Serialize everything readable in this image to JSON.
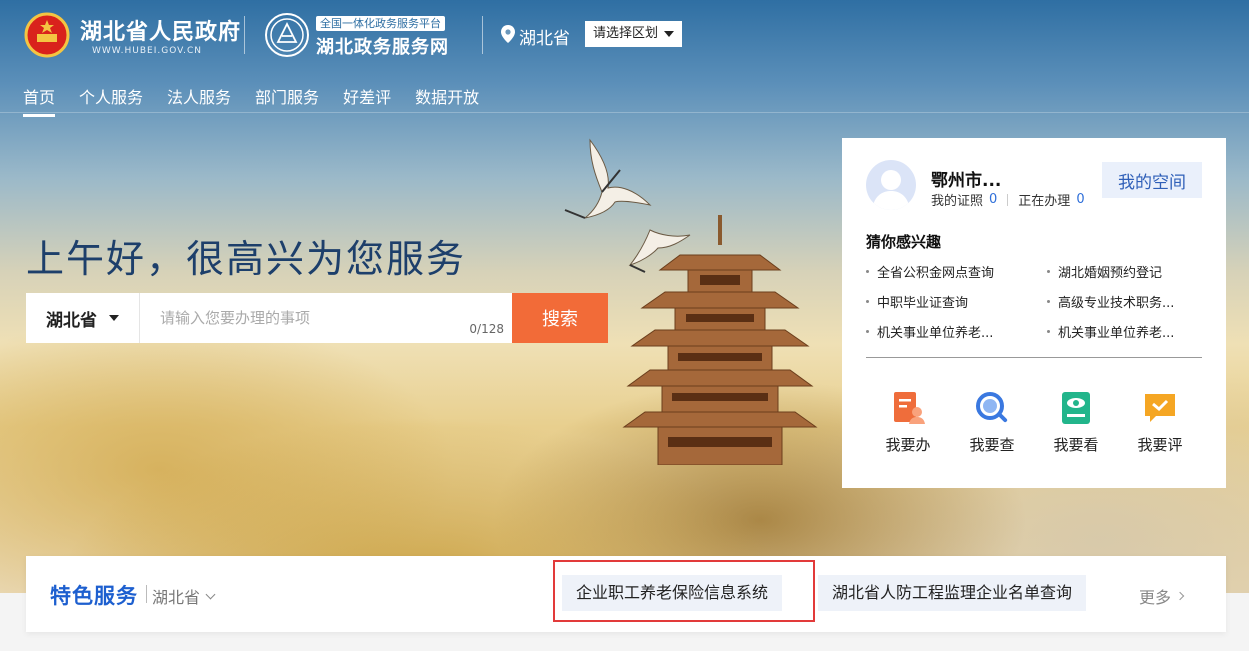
{
  "header": {
    "gov_title": "湖北省人民政府",
    "gov_subtitle": "WWW.HUBEI.GOV.CN",
    "svc_badge": "全国一体化政务服务平台",
    "svc_title": "湖北政务服务网",
    "location": "湖北省",
    "region_button": "请选择区划"
  },
  "nav": [
    {
      "label": "首页",
      "active": true
    },
    {
      "label": "个人服务"
    },
    {
      "label": "法人服务"
    },
    {
      "label": "部门服务"
    },
    {
      "label": "好差评"
    },
    {
      "label": "数据开放"
    }
  ],
  "hero": {
    "greeting": "上午好，很高兴为您服务"
  },
  "search": {
    "region": "湖北省",
    "placeholder": "请输入您要办理的事项",
    "count": "0/128",
    "button": "搜索"
  },
  "user": {
    "name": "鄂州市...",
    "cert_label": "我的证照",
    "cert_count": "0",
    "doing_label": "正在办理",
    "doing_count": "0",
    "space_button": "我的空间"
  },
  "interest": {
    "title": "猜你感兴趣",
    "items": [
      "全省公积金网点查询",
      "湖北婚姻预约登记",
      "中职毕业证查询",
      "高级专业技术职务...",
      "机关事业单位养老...",
      "机关事业单位养老..."
    ]
  },
  "quick": [
    {
      "label": "我要办",
      "icon": "form-person-icon",
      "color": "#ef6d3b"
    },
    {
      "label": "我要查",
      "icon": "search-magnifier-icon",
      "color": "#3a78e0"
    },
    {
      "label": "我要看",
      "icon": "eye-screen-icon",
      "color": "#22b58b"
    },
    {
      "label": "我要评",
      "icon": "chat-check-icon",
      "color": "#f5a623"
    }
  ],
  "featured": {
    "title": "特色服务",
    "region": "湖北省",
    "items": [
      "企业职工养老保险信息系统",
      "湖北省人防工程监理企业名单查询"
    ],
    "more": "更多"
  },
  "colors": {
    "accent_orange": "#f26b38",
    "brand_blue": "#1d5fcf",
    "highlight_red": "#e23a3a"
  }
}
